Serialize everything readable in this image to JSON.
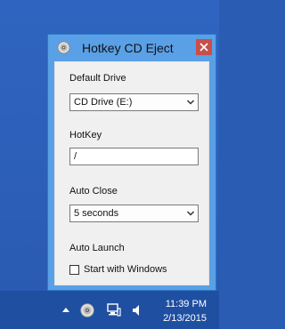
{
  "window": {
    "title": "Hotkey CD Eject",
    "icon": "cd-icon",
    "close_icon": "close-icon"
  },
  "sections": {
    "default_drive": {
      "label": "Default Drive",
      "value": "CD Drive (E:)"
    },
    "hotkey": {
      "label": "HotKey",
      "value": "/"
    },
    "auto_close": {
      "label": "Auto Close",
      "value": "5 seconds"
    },
    "auto_launch": {
      "label": "Auto Launch",
      "checkbox_label": "Start with Windows",
      "checked": false
    }
  },
  "taskbar": {
    "time": "11:39 PM",
    "date": "2/13/2015",
    "tray_icons": [
      "chevron-up-icon",
      "cd-icon",
      "network-icon",
      "volume-icon"
    ]
  },
  "colors": {
    "desktop": "#2c5fb8",
    "window_frame": "#5aa0e6",
    "close_button": "#c7504b",
    "taskbar": "#1f4fa1"
  }
}
